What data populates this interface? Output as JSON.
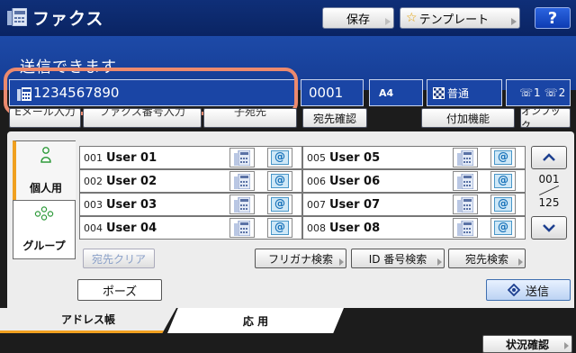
{
  "header": {
    "title": "ファクス",
    "save_label": "保存",
    "template_label": "テンプレート",
    "help_label": "?"
  },
  "status": {
    "message": "送信できます"
  },
  "destination": {
    "number": "1234567890",
    "count": "0001",
    "paper_size": "A4",
    "quality": "普通",
    "line_1": "1",
    "line_2": "2"
  },
  "sub_buttons": {
    "email_input": "Eメール入力",
    "fax_number_input": "ファクス番号入力",
    "subaddress": "子宛先",
    "confirm_destinations": "宛先確認",
    "additional_functions": "付加機能",
    "on_hook": "オンフック"
  },
  "address_tabs": {
    "personal": "個人用",
    "group": "グループ"
  },
  "entries": [
    {
      "number": "001",
      "name": "User 01"
    },
    {
      "number": "002",
      "name": "User 02"
    },
    {
      "number": "003",
      "name": "User 03"
    },
    {
      "number": "004",
      "name": "User 04"
    },
    {
      "number": "005",
      "name": "User 05"
    },
    {
      "number": "006",
      "name": "User 06"
    },
    {
      "number": "007",
      "name": "User 07"
    },
    {
      "number": "008",
      "name": "User 08"
    }
  ],
  "pagination": {
    "current": "001",
    "total": "125"
  },
  "search": {
    "clear": "宛先クリア",
    "furigana": "フリガナ検索",
    "id_number": "ID 番号検索",
    "destination": "宛先検索"
  },
  "actions": {
    "pause": "ポーズ",
    "send": "送信"
  },
  "bottom_tabs": {
    "address_book": "アドレス帳",
    "application": "応 用"
  },
  "status_check": "状況確認",
  "colors": {
    "header": "#0f2f78",
    "status_area": "#1d4aa8",
    "highlight": "#ec8a6e",
    "accent_orange": "#f0a020"
  },
  "icons": [
    "fax-icon",
    "star-icon",
    "checker-icon",
    "line-icon",
    "email-icon",
    "person-icon",
    "group-icon",
    "scroll-up-icon",
    "scroll-down-icon",
    "send-icon"
  ]
}
